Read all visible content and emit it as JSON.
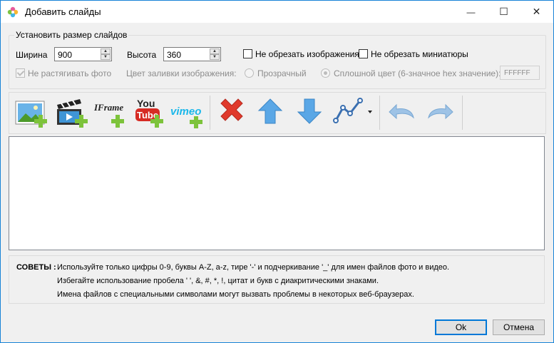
{
  "window": {
    "title": "Добавить слайды",
    "controls": {
      "minimize": "—",
      "maximize": "☐",
      "close": "✕"
    }
  },
  "size_group": {
    "legend": "Установить размер слайдов",
    "width_label": "Ширина",
    "width_value": "900",
    "height_label": "Высота",
    "height_value": "360",
    "no_crop_images_label": "Не обрезать изображения",
    "no_crop_images_checked": false,
    "no_crop_thumbs_label": "Не обрезать миниатюры",
    "no_crop_thumbs_checked": false,
    "no_stretch_label": "Не растягивать фото",
    "no_stretch_checked": true,
    "fill_label": "Цвет заливки изображения:",
    "transparent_label": "Прозрачный",
    "solid_label": "Сплошной цвет (6-значное hex значение):",
    "hex_value": "FFFFFF"
  },
  "toolbar": {
    "buttons": [
      {
        "icon": "add-image-icon",
        "enabled": true
      },
      {
        "icon": "add-video-icon",
        "enabled": true
      },
      {
        "icon": "add-iframe-icon",
        "label": "IFrame",
        "enabled": true
      },
      {
        "icon": "add-youtube-icon",
        "label_top": "You",
        "label_bottom": "Tube",
        "enabled": true
      },
      {
        "icon": "add-vimeo-icon",
        "label": "vimeo",
        "enabled": true
      },
      {
        "icon": "delete-icon",
        "enabled": true
      },
      {
        "icon": "move-up-icon",
        "enabled": true
      },
      {
        "icon": "move-down-icon",
        "enabled": true
      },
      {
        "icon": "sort-chart-icon",
        "enabled": true
      },
      {
        "icon": "undo-icon",
        "enabled": false
      },
      {
        "icon": "redo-icon",
        "enabled": false
      }
    ]
  },
  "tips": {
    "heading": "СОВЕТЫ :",
    "lines": [
      "Используйте только цифры 0-9, буквы A-Z, a-z, тире '-' и подчеркивание '_' для имен файлов фото и видео.",
      "Избегайте использование пробела ' ', &, #, *, !, цитат и букв с диакритическими знаками.",
      "Имена файлов с специальными символами могут вызвать проблемы в некоторых веб-браузерах."
    ]
  },
  "buttons": {
    "ok": "Ok",
    "cancel": "Отмена"
  },
  "colors": {
    "accent": "#0078d7",
    "delete_red": "#e0392b",
    "arrow_blue": "#5aa7e6",
    "plus_green": "#7dc33b"
  }
}
